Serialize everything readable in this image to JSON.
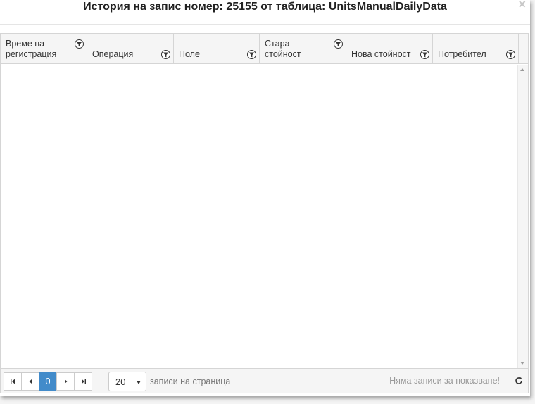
{
  "dialog": {
    "title": "История на запис номер: 25155 от таблица: UnitsManualDailyData",
    "close_glyph": "×"
  },
  "grid": {
    "columns": [
      {
        "label": "Време на\nрегистрация",
        "icon": "filter-icon"
      },
      {
        "label": "Операция",
        "icon": "filter-icon"
      },
      {
        "label": "Поле",
        "icon": "filter-icon"
      },
      {
        "label": "Стара\nстойност",
        "icon": "filter-icon"
      },
      {
        "label": "Нова стойност",
        "icon": "filter-icon"
      },
      {
        "label": "Потребител",
        "icon": "filter-icon"
      }
    ],
    "rows": []
  },
  "pager": {
    "current_page": "0",
    "page_size": "20",
    "per_page_label": "записи на страница",
    "empty_message": "Няма записи за показване!",
    "buttons": [
      "first-page-icon",
      "previous-page-icon",
      "next-page-icon",
      "last-page-icon",
      "refresh-icon"
    ]
  },
  "colors": {
    "accent": "#428bca",
    "header_bg": "#f5f5f5",
    "border": "#d5d5d5"
  }
}
